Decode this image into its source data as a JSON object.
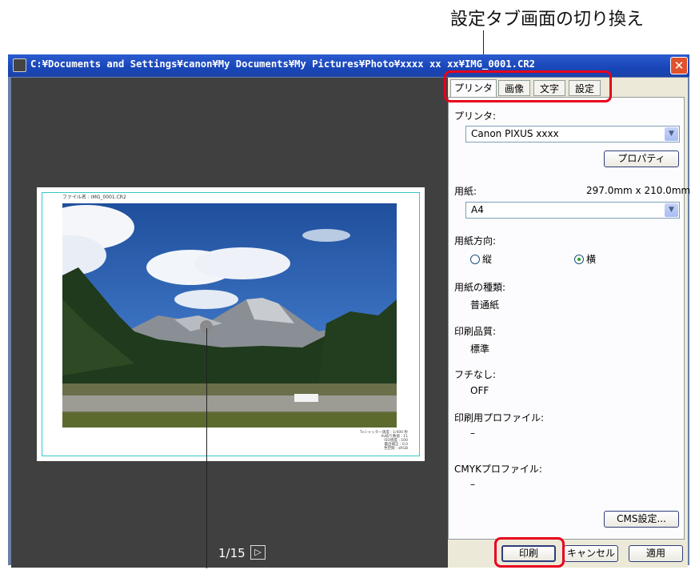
{
  "annotation": {
    "tab_switch_label": "設定タブ画面の切り換え"
  },
  "window": {
    "title": "C:¥Documents and Settings¥canon¥My Documents¥My Pictures¥Photo¥xxxx xx xx¥IMG_0001.CR2",
    "close_symbol": "✕"
  },
  "preview": {
    "file_name_label": "ファイル名 : IMG_0001.CR2",
    "caption_lines": [
      "Tvシャッター速度 : 1/400 秒",
      "Av絞り数値 : 11",
      "ISO感度 : 100",
      "露出補正 : 0.0",
      "色空間 : sRGB"
    ],
    "page_indicator": "1/15",
    "next_symbol": "▷"
  },
  "tabs": [
    {
      "label": "プリンタ",
      "active": true
    },
    {
      "label": "画像",
      "active": false
    },
    {
      "label": "文字",
      "active": false
    },
    {
      "label": "設定",
      "active": false
    }
  ],
  "printer_tab": {
    "printer_label": "プリンタ:",
    "printer_value": "Canon PIXUS xxxx",
    "properties_button": "プロパティ",
    "paper_label": "用紙:",
    "paper_size_text": "297.0mm x 210.0mm",
    "paper_value": "A4",
    "orientation_label": "用紙方向:",
    "orientation_portrait": "縦",
    "orientation_landscape": "横",
    "orientation_selected": "横",
    "paper_type_label": "用紙の種類:",
    "paper_type_value": "普通紙",
    "quality_label": "印刷品質:",
    "quality_value": "標準",
    "borderless_label": "フチなし:",
    "borderless_value": "OFF",
    "print_profile_label": "印刷用プロファイル:",
    "print_profile_value": "–",
    "cmyk_profile_label": "CMYKプロファイル:",
    "cmyk_profile_value": "–",
    "cms_button": "CMS設定..."
  },
  "footer": {
    "print_button": "印刷",
    "cancel_button": "キャンセル",
    "apply_button": "適用"
  },
  "colors": {
    "highlight": "#e8001c",
    "preview_bg": "#404040",
    "titlebar": "#1946b8",
    "panel_bg": "#ece9d8"
  }
}
